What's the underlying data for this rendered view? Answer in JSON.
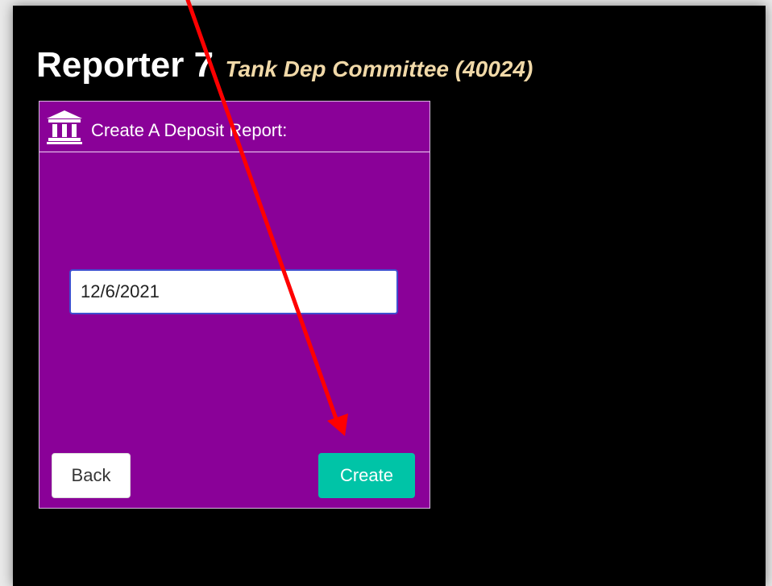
{
  "header": {
    "title": "Reporter 7",
    "subtitle": "Tank Dep Committee (40024)"
  },
  "panel": {
    "icon": "bank-icon",
    "title": "Create A Deposit Report:",
    "date_value": "12/6/2021"
  },
  "buttons": {
    "back_label": "Back",
    "create_label": "Create"
  },
  "colors": {
    "background": "#000000",
    "panel": "#8a0198",
    "subtitle": "#f1d9a8",
    "create_button": "#00c4a7",
    "annotation_arrow": "#ff0000"
  },
  "annotation": {
    "type": "arrow",
    "points_to": "create-button"
  }
}
